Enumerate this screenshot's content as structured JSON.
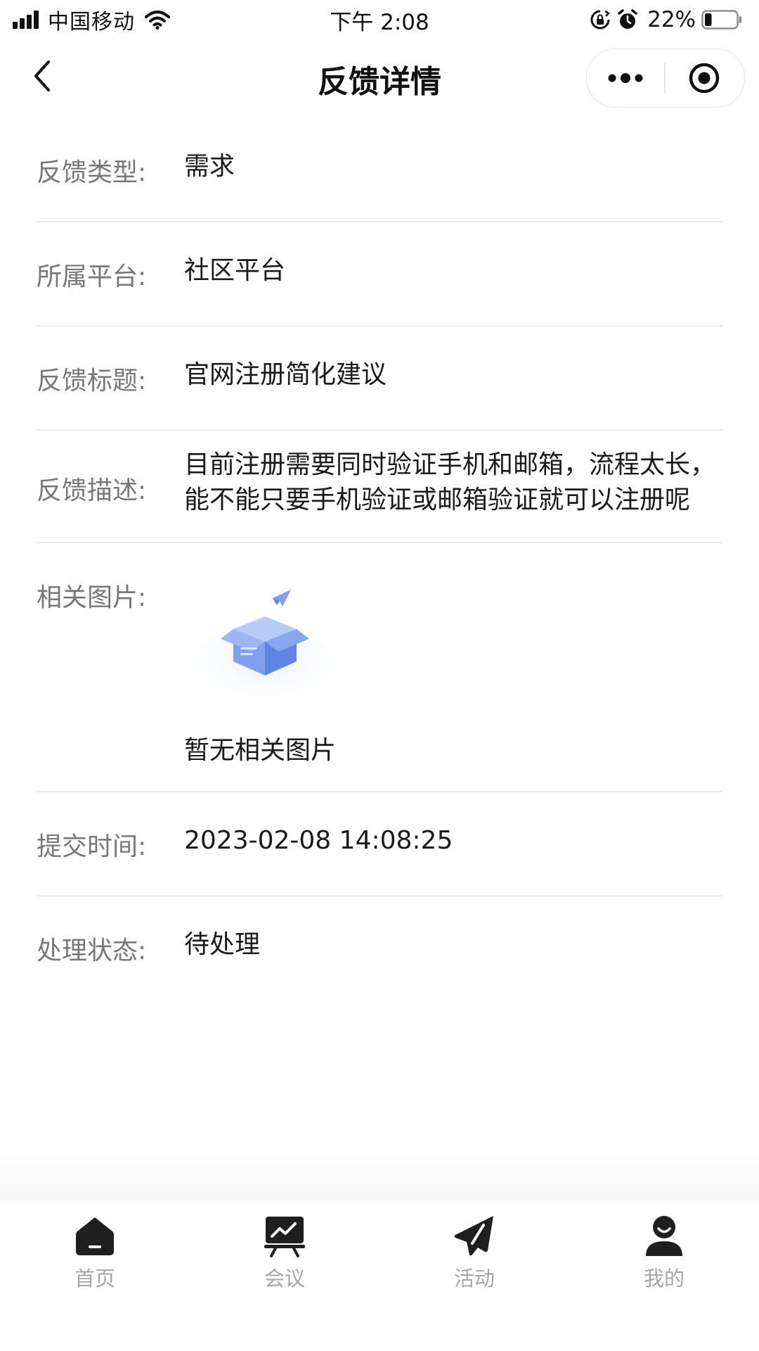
{
  "status_bar": {
    "carrier": "中国移动",
    "time": "下午 2:08",
    "battery_percent": "22%",
    "battery_level": 0.22,
    "icons": [
      "signal-icon",
      "wifi-icon",
      "rotation-lock-icon",
      "alarm-icon",
      "battery-icon"
    ]
  },
  "nav": {
    "title": "反馈详情",
    "icons": [
      "back-icon",
      "more-icon",
      "target-icon"
    ]
  },
  "details": {
    "type_label": "反馈类型:",
    "type_value": "需求",
    "platform_label": "所属平台:",
    "platform_value": "社区平台",
    "title_label": "反馈标题:",
    "title_value": "官网注册简化建议",
    "desc_label": "反馈描述:",
    "desc_value": "目前注册需要同时验证手机和邮箱，流程太长，能不能只要手机验证或邮箱验证就可以注册呢",
    "images_label": "相关图片:",
    "images_empty": "暂无相关图片",
    "time_label": "提交时间:",
    "time_value": "2023-02-08 14:08:25",
    "status_label": "处理状态:",
    "status_value": "待处理"
  },
  "tabbar": {
    "items": [
      {
        "label": "首页",
        "icon": "home-icon"
      },
      {
        "label": "会议",
        "icon": "meeting-icon"
      },
      {
        "label": "活动",
        "icon": "activity-icon"
      },
      {
        "label": "我的",
        "icon": "profile-icon"
      }
    ]
  },
  "colors": {
    "label": "#777777",
    "value": "#1a1a1a",
    "divider": "#ececec",
    "tab_label": "#a6a6a6",
    "tab_icon": "#1f1f1f",
    "empty_box": "#6f93e8"
  }
}
